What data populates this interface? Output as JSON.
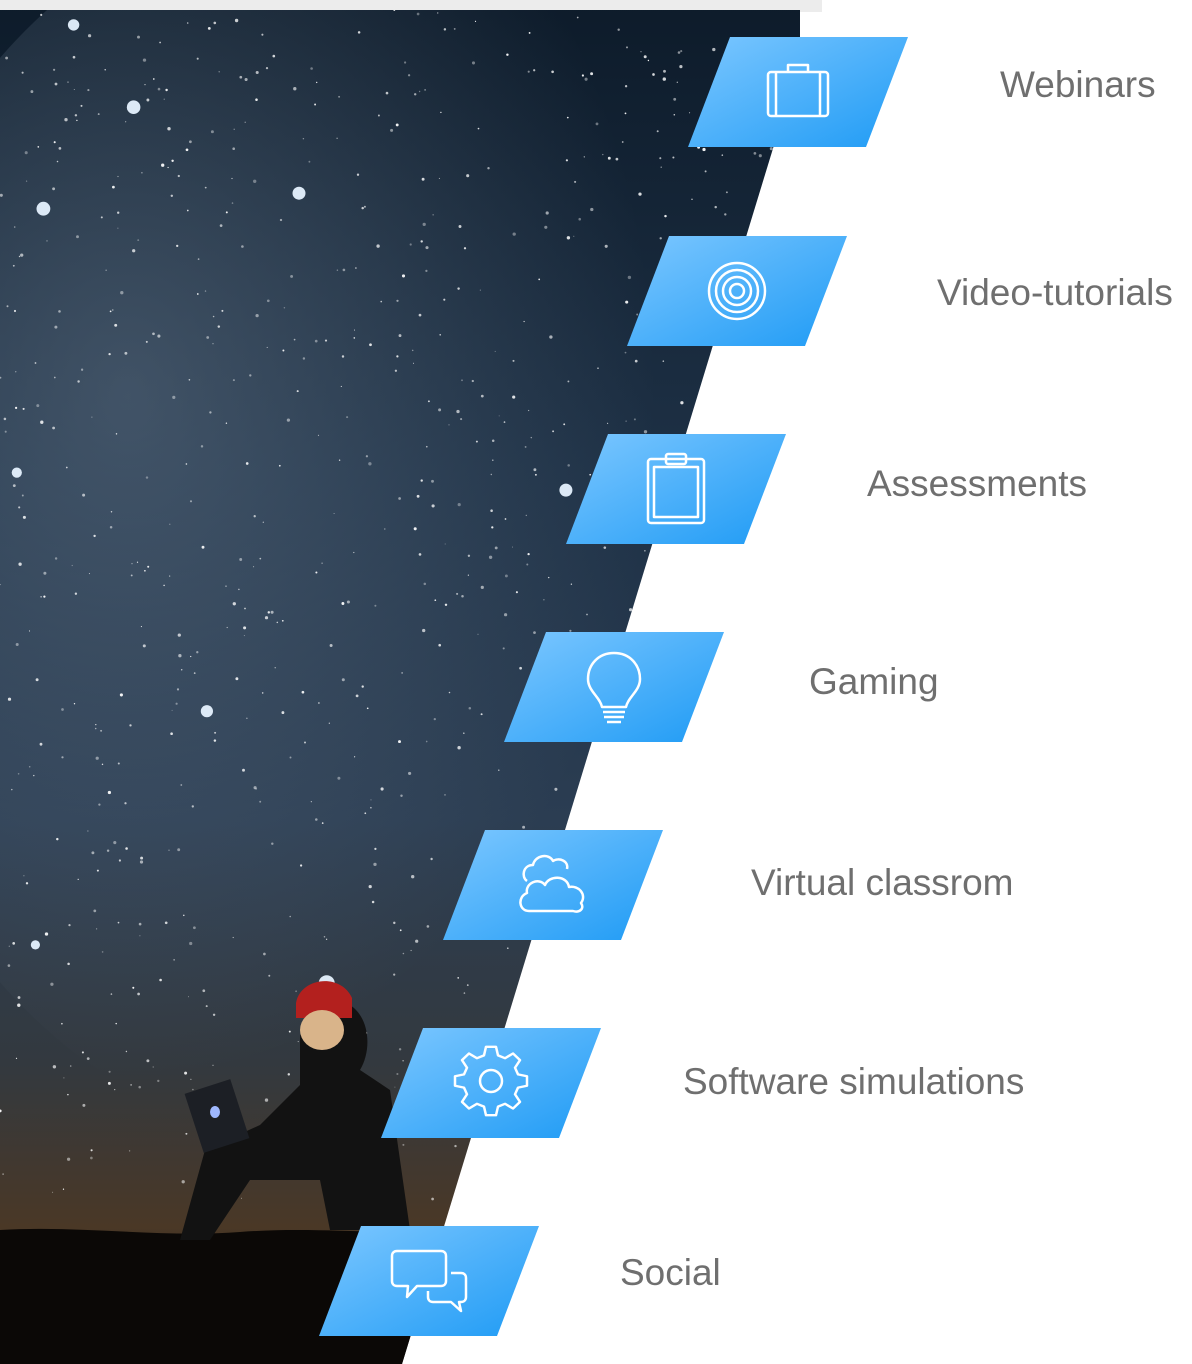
{
  "colors": {
    "tile_light": "#7cc7ff",
    "tile_dark": "#1f9bf5",
    "label_text": "#6f6f6f",
    "sky_top": "#0f1e2e",
    "sky_mid": "#2a3c50",
    "horizon": "#5a3e2a"
  },
  "features": [
    {
      "label": "Webinars",
      "icon": "briefcase-icon"
    },
    {
      "label": "Video-tutorials",
      "icon": "target-icon"
    },
    {
      "label": "Assessments",
      "icon": "clipboard-icon"
    },
    {
      "label": "Gaming",
      "icon": "lightbulb-icon"
    },
    {
      "label": "Virtual classrom",
      "icon": "cloud-icon"
    },
    {
      "label": "Software simulations",
      "icon": "gear-icon"
    },
    {
      "label": "Social",
      "icon": "chat-bubbles-icon"
    }
  ]
}
